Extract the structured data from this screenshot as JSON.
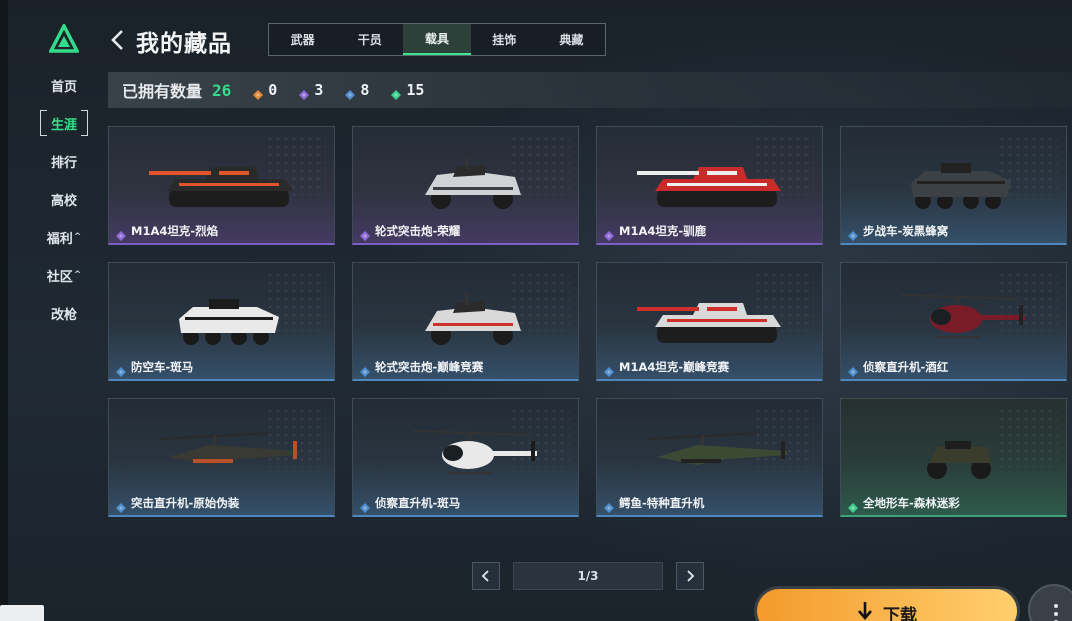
{
  "sidebar": {
    "items": [
      {
        "label": "首页",
        "active": false,
        "caret": ""
      },
      {
        "label": "生涯",
        "active": true,
        "caret": ""
      },
      {
        "label": "排行",
        "active": false,
        "caret": ""
      },
      {
        "label": "高校",
        "active": false,
        "caret": ""
      },
      {
        "label": "福利",
        "active": false,
        "caret": "^"
      },
      {
        "label": "社区",
        "active": false,
        "caret": "^"
      },
      {
        "label": "改枪",
        "active": false,
        "caret": ""
      }
    ]
  },
  "header": {
    "title": "我的藏品",
    "tabs": [
      {
        "label": "武器",
        "active": false
      },
      {
        "label": "干员",
        "active": false
      },
      {
        "label": "载具",
        "active": true
      },
      {
        "label": "挂饰",
        "active": false
      },
      {
        "label": "典藏",
        "active": false
      }
    ]
  },
  "stats": {
    "owned_label": "已拥有数量",
    "owned_total": "26",
    "tiers": [
      {
        "icon": "orange-diamond-icon",
        "color": "#e08a3a",
        "count": "0"
      },
      {
        "icon": "purple-diamond-icon",
        "color": "#8f6ad8",
        "count": "3"
      },
      {
        "icon": "blue-diamond-icon",
        "color": "#4f8fd0",
        "count": "8"
      },
      {
        "icon": "green-diamond-icon",
        "color": "#3ecf8e",
        "count": "15"
      }
    ]
  },
  "collection": {
    "items": [
      {
        "name": "M1A4坦克-烈焰",
        "tier": "purple",
        "kind": "tank",
        "skin": "flame"
      },
      {
        "name": "轮式突击炮-荣耀",
        "tier": "purple",
        "kind": "buggy",
        "skin": "white"
      },
      {
        "name": "M1A4坦克-驯鹿",
        "tier": "purple",
        "kind": "tank",
        "skin": "red"
      },
      {
        "name": "步战车-炭黑蜂窝",
        "tier": "blue",
        "kind": "apc",
        "skin": "dark"
      },
      {
        "name": "防空车-斑马",
        "tier": "blue",
        "kind": "apc",
        "skin": "zebra"
      },
      {
        "name": "轮式突击炮-巅峰竞赛",
        "tier": "blue",
        "kind": "buggy",
        "skin": "race"
      },
      {
        "name": "M1A4坦克-巅峰竞赛",
        "tier": "blue",
        "kind": "tank",
        "skin": "race"
      },
      {
        "name": "侦察直升机-酒红",
        "tier": "blue",
        "kind": "littlebird",
        "skin": "wine"
      },
      {
        "name": "突击直升机-原始伪装",
        "tier": "blue",
        "kind": "apache",
        "skin": "camo"
      },
      {
        "name": "侦察直升机-斑马",
        "tier": "blue",
        "kind": "littlebird",
        "skin": "zebra"
      },
      {
        "name": "鳄鱼-特种直升机",
        "tier": "blue",
        "kind": "apache",
        "skin": "green"
      },
      {
        "name": "全地形车-森林迷彩",
        "tier": "green",
        "kind": "atv",
        "skin": "forest"
      }
    ]
  },
  "pagination": {
    "current": "1/3"
  },
  "download": {
    "label": "下载"
  },
  "colors": {
    "accent": "#33dc8a",
    "purple": "#8f6ad8",
    "blue": "#4f8fd0",
    "green": "#3ecf8e",
    "download": "#f6a43a"
  }
}
